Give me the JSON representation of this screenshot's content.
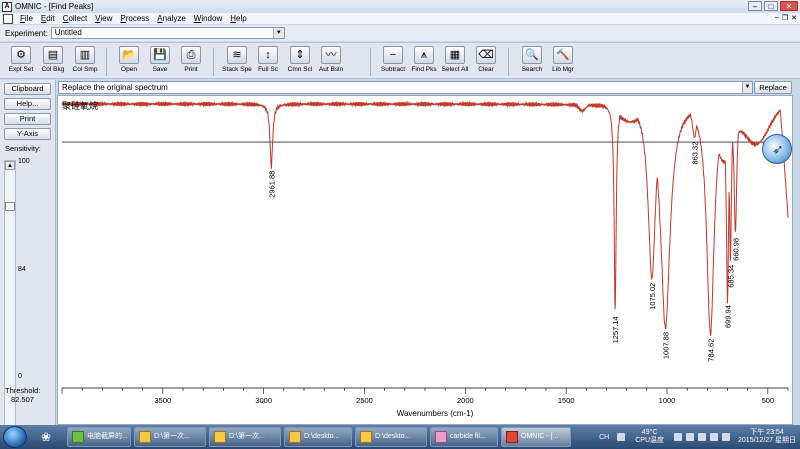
{
  "window": {
    "title": "OMNIC - [Find Peaks]",
    "menu": [
      "File",
      "Edit",
      "Collect",
      "View",
      "Process",
      "Analyze",
      "Window",
      "Help"
    ]
  },
  "experiment": {
    "label": "Experiment:",
    "value": "Untitled"
  },
  "toolbar": {
    "buttons": [
      {
        "label": "Expt Set",
        "icon": "expt-set-icon"
      },
      {
        "label": "Col Bkg",
        "icon": "col-bkg-icon"
      },
      {
        "label": "Col Smp",
        "icon": "col-smp-icon"
      },
      {
        "label": "Open",
        "icon": "open-icon"
      },
      {
        "label": "Save",
        "icon": "save-icon"
      },
      {
        "label": "Print",
        "icon": "print-icon"
      },
      {
        "label": "Stack Spe",
        "icon": "stack-spectra-icon"
      },
      {
        "label": "Full Sc",
        "icon": "full-scale-icon"
      },
      {
        "label": "Cmn Scl",
        "icon": "common-scale-icon"
      },
      {
        "label": "Aut Bsln",
        "icon": "auto-baseline-icon"
      },
      {
        "label": "Subtract",
        "icon": "subtract-icon"
      },
      {
        "label": "Find Pks",
        "icon": "find-peaks-icon"
      },
      {
        "label": "Select All",
        "icon": "select-all-icon"
      },
      {
        "label": "Clear",
        "icon": "clear-icon"
      },
      {
        "label": "Search",
        "icon": "search-icon"
      },
      {
        "label": "Lib Mgr",
        "icon": "library-manager-icon"
      }
    ]
  },
  "left_panel": {
    "clipboard": "Clipboard",
    "help": "Help...",
    "print": "Print",
    "y_axis": "Y-Axis",
    "sensitivity_label": "Sensitivity:",
    "sensitivity_max": "100",
    "sensitivity_mid": "84",
    "sensitivity_min": "0",
    "threshold_label": "Threshold:",
    "threshold_value": "82.507"
  },
  "command": {
    "text": "Replace the original spectrum",
    "replace_button": "Replace"
  },
  "spectrum": {
    "sample_name": "聚硅氧烷",
    "line_color": "#c0392b"
  },
  "chart_data": {
    "type": "line",
    "xlabel": "Wavenumbers (cm-1)",
    "xlim": [
      4000,
      400
    ],
    "x_ticks": [
      "3500",
      "3000",
      "2500",
      "2000",
      "1500",
      "1000",
      "500"
    ],
    "x_tick_values": [
      3500,
      3000,
      2500,
      2000,
      1500,
      1000,
      500
    ],
    "peaks": [
      {
        "x": 2961.88,
        "label": "2961.88",
        "depth": 0.28
      },
      {
        "x": 1257.14,
        "label": "1257.14",
        "depth": 0.93
      },
      {
        "x": 1075.02,
        "label": "1075.02",
        "depth": 0.78
      },
      {
        "x": 1007.88,
        "label": "1007.88",
        "depth": 1.0
      },
      {
        "x": 863.32,
        "label": "863.32",
        "depth": 0.15
      },
      {
        "x": 784.62,
        "label": "784.62",
        "depth": 1.03
      },
      {
        "x": 699.94,
        "label": "699.94",
        "depth": 0.88
      },
      {
        "x": 685.34,
        "label": "685.34",
        "depth": 0.7
      },
      {
        "x": 660.98,
        "label": "660.98",
        "depth": 0.58
      }
    ],
    "threshold_depth": 0.17
  },
  "taskbar": {
    "tasks": [
      {
        "label": "电脑截屏的...",
        "active": false
      },
      {
        "label": "D:\\第一次...",
        "active": false
      },
      {
        "label": "D:\\第一次...",
        "active": false
      },
      {
        "label": "D:\\deskto...",
        "active": false
      },
      {
        "label": "D:\\deskto...",
        "active": false
      },
      {
        "label": "carbide fil...",
        "active": false
      },
      {
        "label": "OMNIC - [...",
        "active": true
      }
    ],
    "lang": "CH",
    "cpu_temp": "49°C",
    "cpu_label": "CPU温度",
    "time": "下午 23:54",
    "date": "2015/12/27 星期日"
  }
}
